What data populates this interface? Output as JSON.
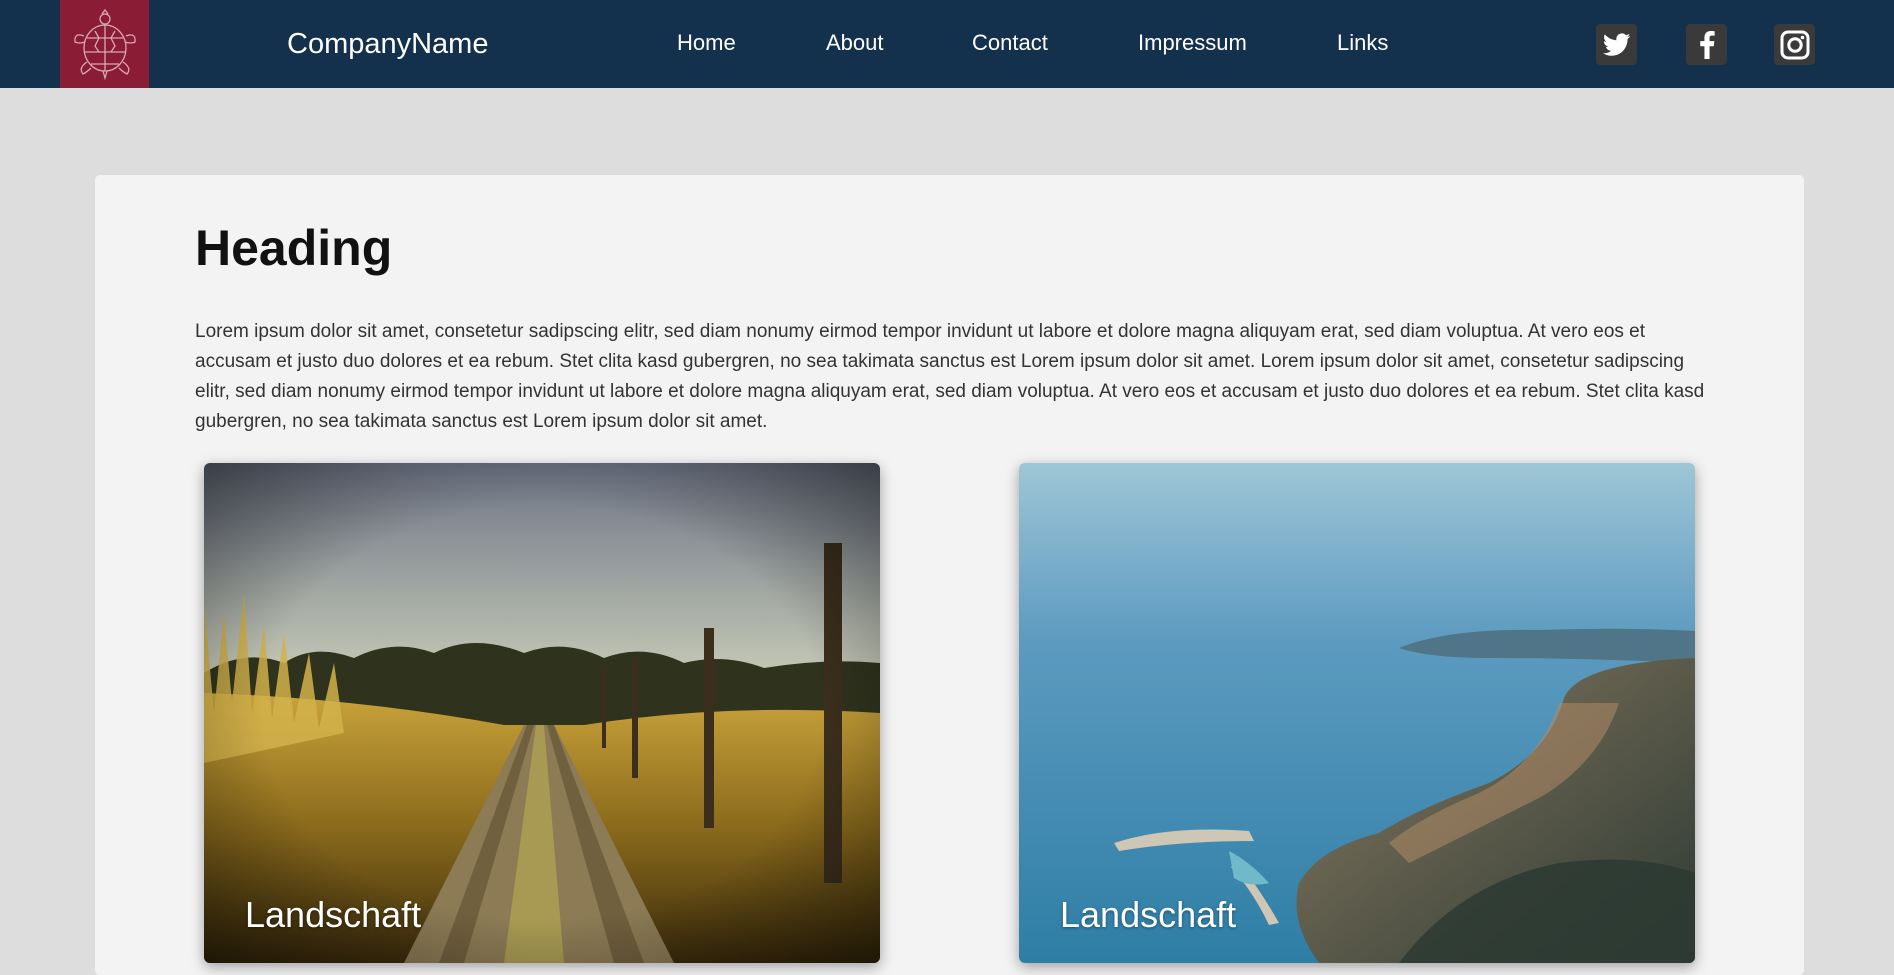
{
  "brand": {
    "company_name": "CompanyName",
    "logo_color": "#8b1c36",
    "nav_color": "#13304d"
  },
  "nav": {
    "items": [
      {
        "label": "Home"
      },
      {
        "label": "About"
      },
      {
        "label": "Contact"
      },
      {
        "label": "Impressum"
      },
      {
        "label": "Links"
      }
    ]
  },
  "social": {
    "icons": [
      "twitter-icon",
      "facebook-icon",
      "instagram-icon"
    ]
  },
  "content": {
    "heading": "Heading",
    "paragraph": "Lorem ipsum dolor sit amet, consetetur sadipscing elitr, sed diam nonumy eirmod tempor invidunt ut labore et dolore magna aliquyam erat, sed diam voluptua. At vero eos et accusam et justo duo dolores et ea rebum. Stet clita kasd gubergren, no sea takimata sanctus est Lorem ipsum dolor sit amet. Lorem ipsum dolor sit amet, consetetur sadipscing elitr, sed diam nonumy eirmod tempor invidunt ut labore et dolore magna aliquyam erat, sed diam voluptua. At vero eos et accusam et justo duo dolores et ea rebum. Stet clita kasd gubergren, no sea takimata sanctus est Lorem ipsum dolor sit amet."
  },
  "gallery": [
    {
      "label": "Landschaft"
    },
    {
      "label": "Landschaft"
    }
  ]
}
